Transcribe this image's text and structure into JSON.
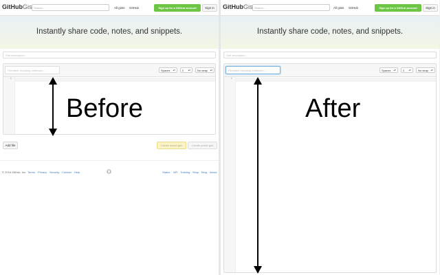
{
  "header": {
    "logo_brand": "GitHub",
    "logo_gist": "Gist",
    "search_placeholder": "Search...",
    "all_gists": "All gists",
    "github_link": "GitHub",
    "signup": "Sign up for a GitHub account",
    "signin": "Sign in"
  },
  "banner": {
    "tagline": "Instantly share code, notes, and snippets."
  },
  "form": {
    "description_placeholder": "Gist description...",
    "filename_placeholder": "Filename including extension...",
    "indent_mode": "Spaces",
    "indent_size": "2",
    "wrap_mode": "No wrap",
    "line_number": "1",
    "add_file": "Add file",
    "create_secret": "Create secret gist",
    "create_public": "Create public gist"
  },
  "footer": {
    "copyright": "© 2016 GitHub, Inc.",
    "left_links": [
      "Terms",
      "Privacy",
      "Security",
      "Contact",
      "Help"
    ],
    "right_links": [
      "Status",
      "API",
      "Training",
      "Shop",
      "Blog",
      "About"
    ]
  },
  "labels": {
    "before": "Before",
    "after": "After"
  },
  "colors": {
    "signup_green": "#6cc644",
    "link_blue": "#4078c0",
    "focus_blue": "#74b3df"
  }
}
